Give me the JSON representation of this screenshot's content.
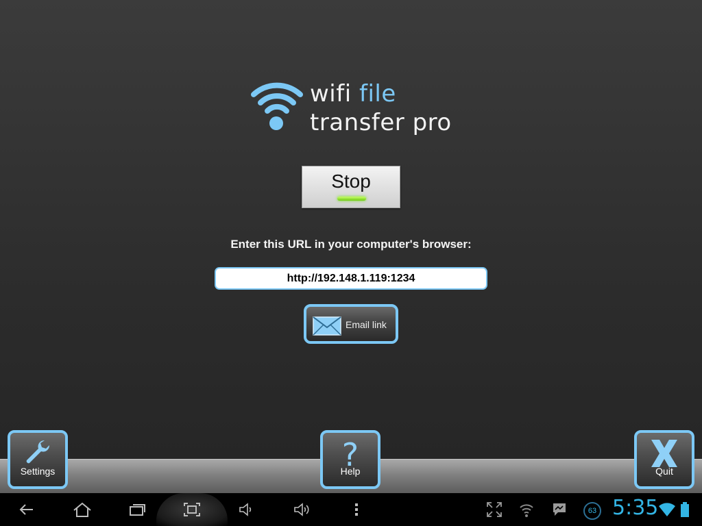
{
  "logo": {
    "line1_plain": "wifi",
    "line1_accent": "file",
    "line2": "transfer pro",
    "icon": "wifi-icon"
  },
  "server": {
    "toggle_label": "Stop",
    "status_light": "on"
  },
  "instruction": "Enter this URL in your computer's browser:",
  "url": "http://192.148.1.119:1234",
  "email_link": {
    "label": "Email link",
    "icon": "envelope-icon"
  },
  "toolbar": {
    "settings": {
      "label": "Settings",
      "icon": "wrench-icon"
    },
    "help": {
      "label": "Help",
      "icon": "question-icon"
    },
    "quit": {
      "label": "Quit",
      "icon": "x-icon"
    }
  },
  "system_bar": {
    "time": "5:35",
    "notification_count": "63",
    "nav_icons": [
      "back-icon",
      "home-icon",
      "recent-apps-icon",
      "screenshot-icon",
      "volume-down-icon",
      "volume-up-icon",
      "menu-icon"
    ],
    "status_icons": [
      "fullscreen-icon",
      "wifi-icon",
      "messenger-icon",
      "notification-badge",
      "wifi-icon",
      "battery-icon"
    ]
  },
  "colors": {
    "accent": "#7cc8f5",
    "clock": "#33b5e5",
    "led_on": "#7be023"
  }
}
